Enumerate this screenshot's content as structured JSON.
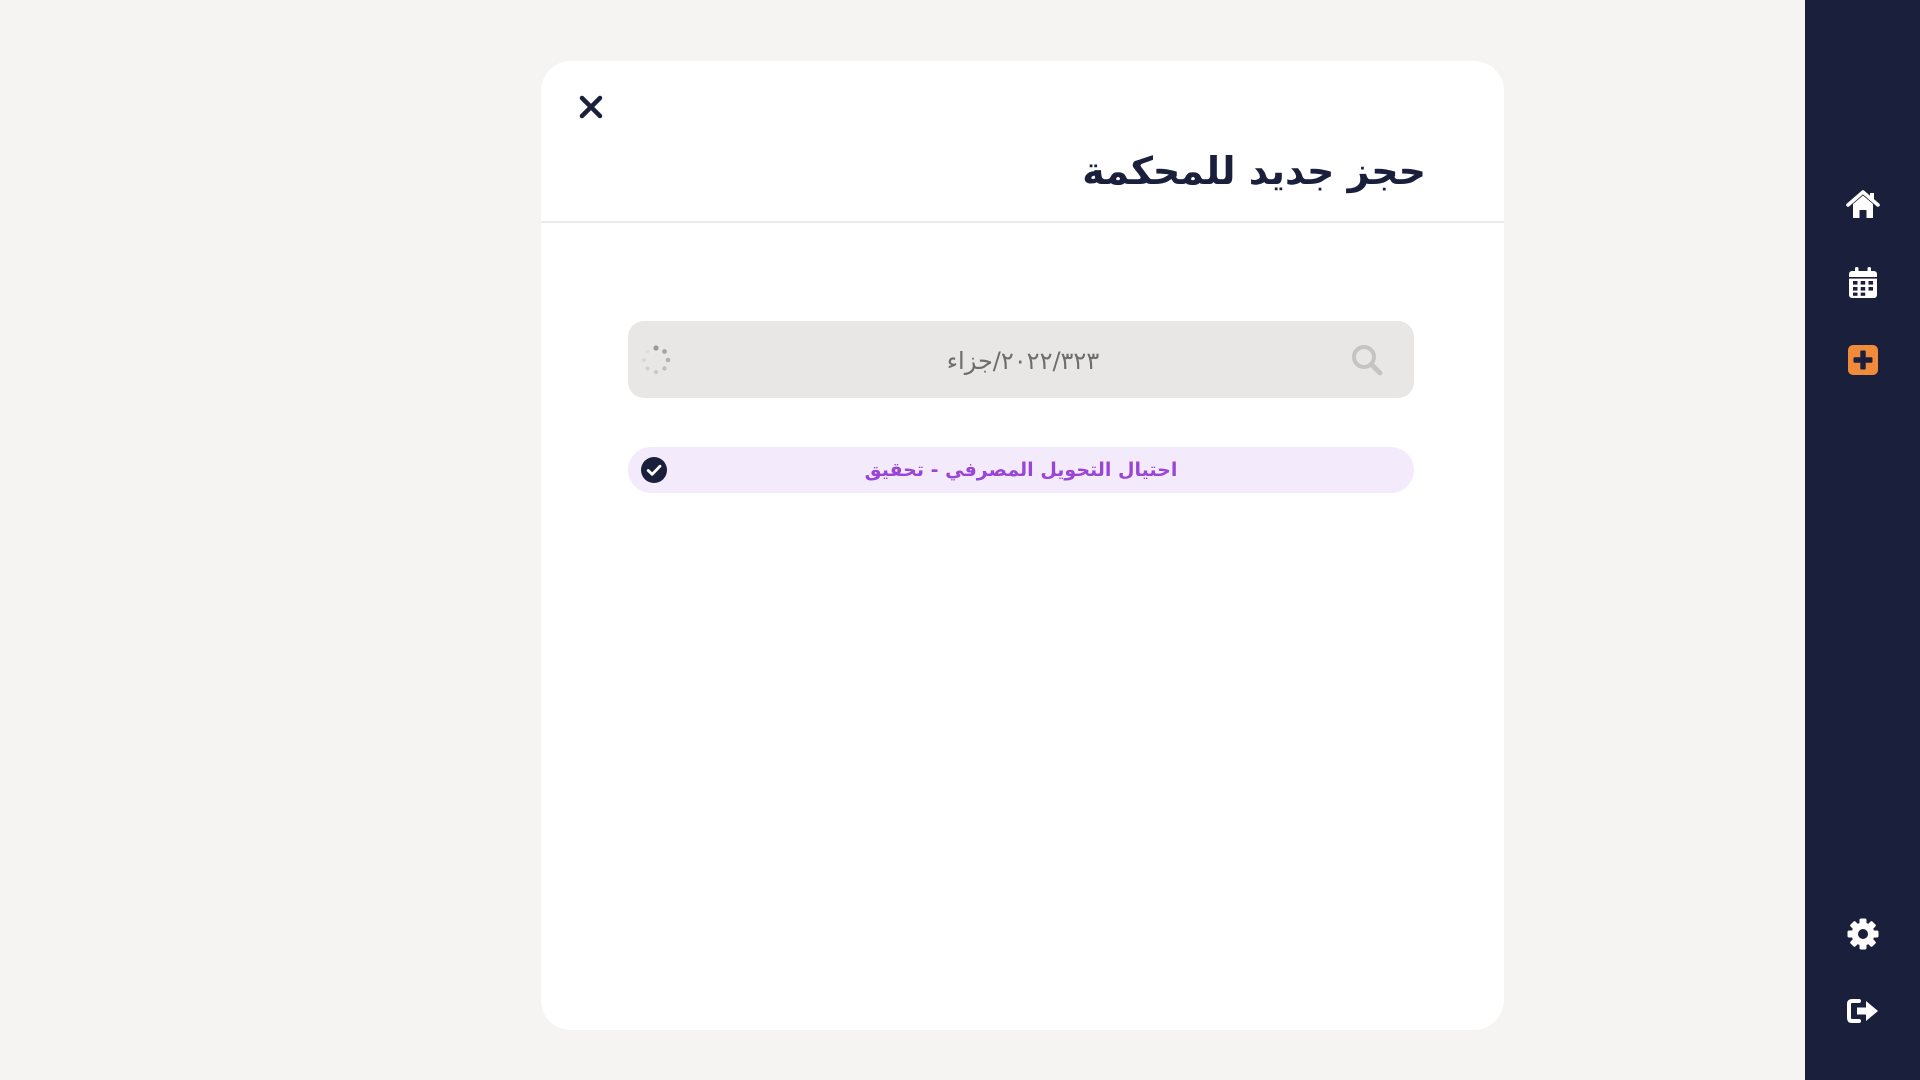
{
  "modal": {
    "title": "حجز جديد للمحكمة",
    "search": {
      "value": "٢٠٢٢/٣٢٣/جزاء",
      "placeholder": ""
    },
    "results": [
      {
        "label": "احتيال التحويل المصرفي - تحقيق",
        "selected": true
      }
    ],
    "icons": {
      "close": "close-icon",
      "search": "search-icon",
      "loading": "spinner-icon",
      "selected": "check-circle-icon"
    }
  },
  "sidebar": {
    "items": [
      {
        "icon": "home-icon",
        "active": false
      },
      {
        "icon": "calendar-icon",
        "active": false
      },
      {
        "icon": "add-icon",
        "active": true
      },
      {
        "icon": "gear-icon",
        "active": false
      },
      {
        "icon": "logout-icon",
        "active": false
      }
    ]
  },
  "colors": {
    "page_background": "#f6f4f3",
    "sidebar_background": "#1a1f3c",
    "accent_orange": "#f08b3c",
    "result_text": "#9a45d4",
    "result_background": "#f3ebfb"
  }
}
